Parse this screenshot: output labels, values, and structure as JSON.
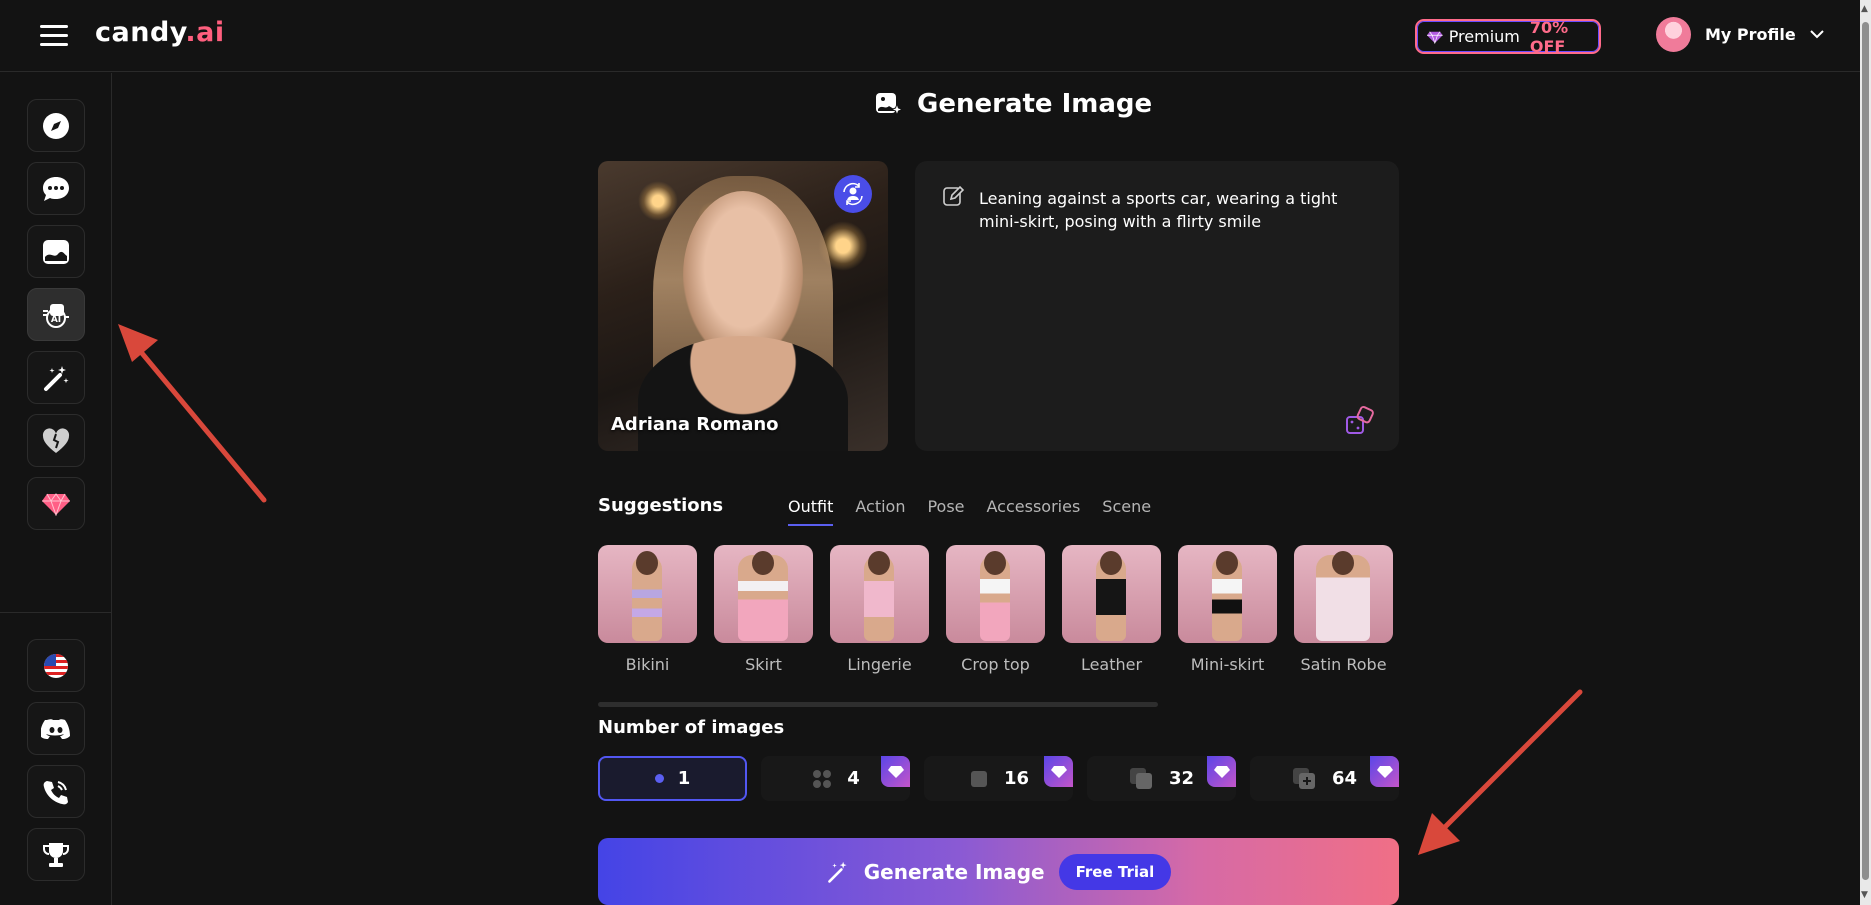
{
  "brand": {
    "name": "candy",
    "suffix": ".ai"
  },
  "header": {
    "premium_label": "Premium",
    "premium_discount": "70% OFF",
    "profile_label": "My Profile"
  },
  "sidebar": {
    "top_items": [
      "explore-icon",
      "chat-icon",
      "gallery-icon",
      "generate-image-icon",
      "magic-wand-icon",
      "heart-icon",
      "premium-gem-icon"
    ],
    "bottom_items": [
      "us-flag-icon",
      "discord-icon",
      "phone-icon",
      "trophy-icon"
    ]
  },
  "page": {
    "title": "Generate Image"
  },
  "character": {
    "name": "Adriana Romano"
  },
  "prompt": {
    "text": "Leaning against a sports car, wearing a tight mini-skirt, posing with a flirty smile"
  },
  "suggestions": {
    "title": "Suggestions",
    "tabs": [
      "Outfit",
      "Action",
      "Pose",
      "Accessories",
      "Scene"
    ],
    "active_tab": "Outfit",
    "items": [
      "Bikini",
      "Skirt",
      "Lingerie",
      "Crop top",
      "Leather",
      "Mini-skirt",
      "Satin Robe"
    ]
  },
  "images": {
    "title": "Number of images",
    "options": [
      "1",
      "4",
      "16",
      "32",
      "64"
    ],
    "selected": "1"
  },
  "generate": {
    "label": "Generate Image",
    "badge": "Free Trial"
  },
  "colors": {
    "accent": "#5b5ff0",
    "brand_pink": "#ff5f7e",
    "annotation_arrow": "#d9483b"
  }
}
